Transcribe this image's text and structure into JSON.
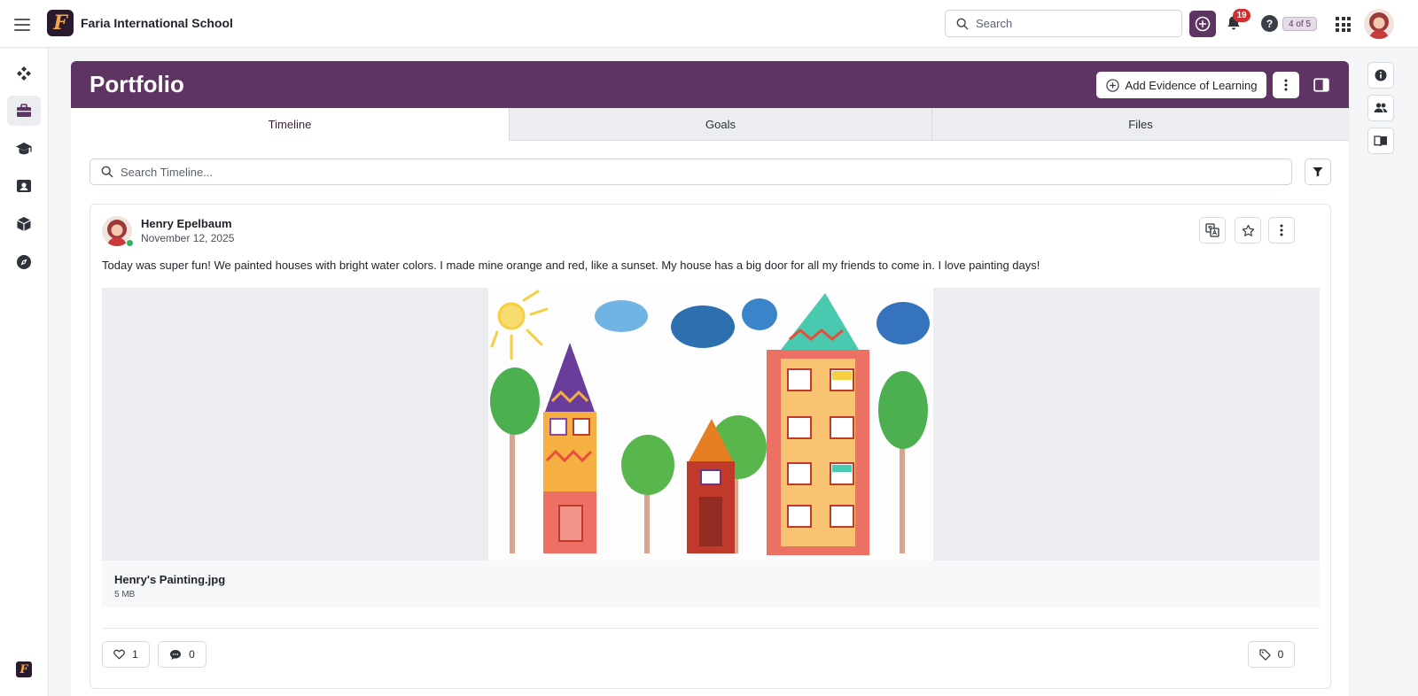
{
  "topbar": {
    "school_name": "Faria International School",
    "logo_letter": "F",
    "search_placeholder": "Search",
    "notification_count": "19",
    "help_glyph": "?",
    "step_badge": "4 of 5"
  },
  "portfolio": {
    "title": "Portfolio",
    "add_evidence_label": "Add Evidence of Learning"
  },
  "tabs": [
    {
      "label": "Timeline",
      "active": true
    },
    {
      "label": "Goals",
      "active": false
    },
    {
      "label": "Files",
      "active": false
    }
  ],
  "timeline": {
    "search_placeholder": "Search Timeline..."
  },
  "post": {
    "author": "Henry Epelbaum",
    "date": "November 12, 2025",
    "text": "Today was super fun! We painted houses with bright water colors. I made mine orange and red, like a sunset. My house has a big door for all my friends to come in. I love painting days!",
    "attachment": {
      "name": "Henry's Painting.jpg",
      "size": "5 MB"
    },
    "likes": "1",
    "comments": "0",
    "tags": "0"
  },
  "icons": {
    "sidebar": [
      "diamonds-icon",
      "briefcase-icon",
      "graduation-cap-icon",
      "report-icon",
      "cube-icon",
      "compass-icon"
    ],
    "right_panel": [
      "info-icon",
      "people-icon",
      "book-icon"
    ]
  },
  "colors": {
    "brand": "#5e3562",
    "badge_red": "#d32f2f",
    "online_green": "#2fb35a"
  }
}
